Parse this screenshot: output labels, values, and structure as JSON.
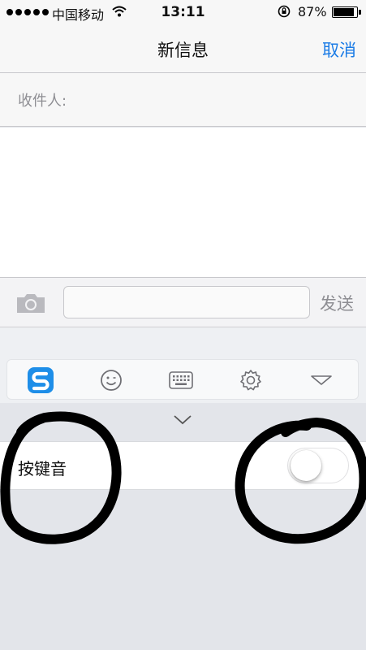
{
  "status_bar": {
    "carrier": "中国移动",
    "time": "13:11",
    "battery_percent": "87%",
    "battery_level": 0.87
  },
  "nav": {
    "title": "新信息",
    "cancel_label": "取消"
  },
  "recipient": {
    "label": "收件人:",
    "value": ""
  },
  "compose": {
    "value": "",
    "send_label": "发送"
  },
  "keyboard_toolbar": {
    "items": [
      "sogou-logo-icon",
      "emoji-icon",
      "keyboard-icon",
      "settings-icon",
      "hide-keyboard-icon"
    ]
  },
  "settings": {
    "key_sound_label": "按键音",
    "key_sound_enabled": false
  },
  "colors": {
    "accent": "#1a7be6",
    "sogou_blue": "#1e8ee8",
    "annotation": "#000000"
  }
}
